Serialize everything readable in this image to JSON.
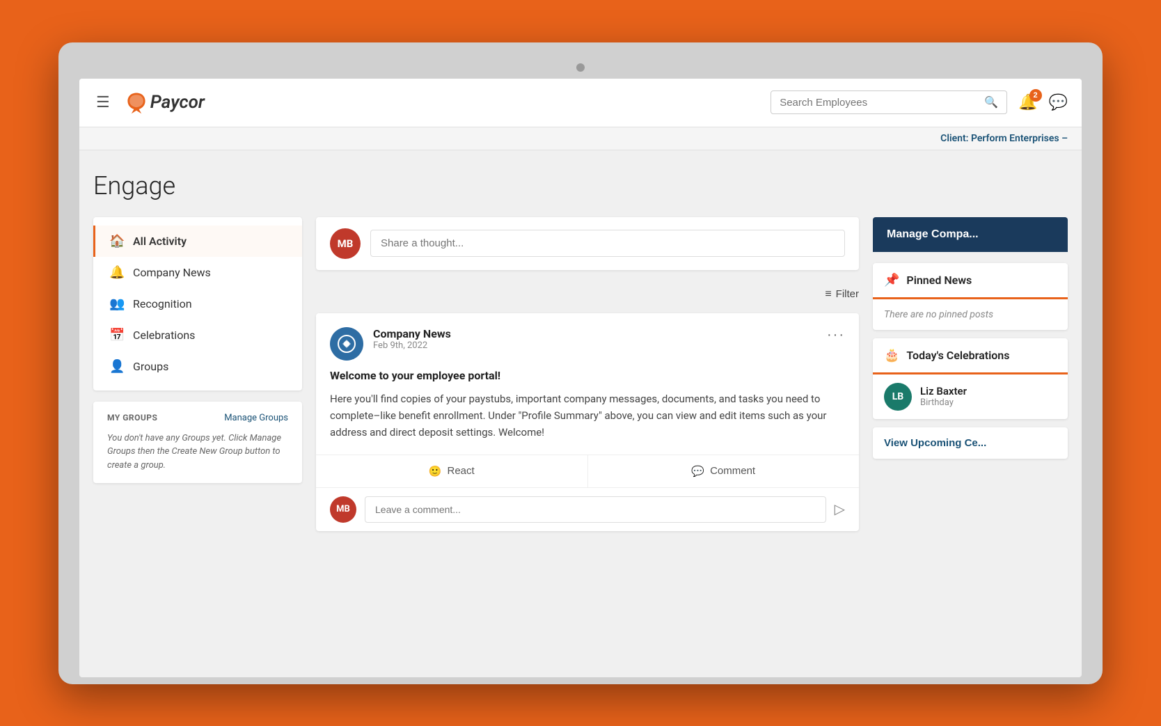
{
  "app": {
    "title": "Paycor",
    "logo_text": "Paycor"
  },
  "header": {
    "menu_icon": "☰",
    "search_placeholder": "Search Employees",
    "notification_count": "2",
    "client_label": "Client:",
    "client_name": "Perform Enterprises –"
  },
  "page": {
    "title": "Engage"
  },
  "sidebar": {
    "nav_items": [
      {
        "id": "all-activity",
        "label": "All Activity",
        "icon": "🏠",
        "active": true
      },
      {
        "id": "company-news",
        "label": "Company News",
        "icon": "🔔",
        "active": false
      },
      {
        "id": "recognition",
        "label": "Recognition",
        "icon": "👥",
        "active": false
      },
      {
        "id": "celebrations",
        "label": "Celebrations",
        "icon": "📅",
        "active": false
      },
      {
        "id": "groups",
        "label": "Groups",
        "icon": "👤",
        "active": false
      }
    ],
    "my_groups_label": "MY GROUPS",
    "manage_groups_link": "Manage Groups",
    "my_groups_empty_text": "You don't have any Groups yet. Click Manage Groups then the Create New Group button to create a group."
  },
  "composer": {
    "user_initials": "MB",
    "placeholder": "Share a thought..."
  },
  "filter": {
    "label": "Filter"
  },
  "post": {
    "avatar_icon": "◈",
    "author": "Company News",
    "date": "Feb 9th, 2022",
    "title": "Welcome to your employee portal!",
    "body": "Here you'll find copies of your paystubs, important company messages, documents, and tasks you need to complete–like benefit enrollment. Under \"Profile Summary\" above, you can view and edit items such as your address and direct deposit settings. Welcome!",
    "react_label": "React",
    "comment_label": "Comment",
    "comment_placeholder": "Leave a comment...",
    "user_initials": "MB"
  },
  "right_sidebar": {
    "manage_company_label": "Manage Compa...",
    "pinned_news": {
      "title": "Pinned News",
      "empty_text": "There are no pinned posts"
    },
    "todays_celebrations": {
      "title": "Today's Celebrations",
      "person_name": "Liz Baxter",
      "person_initials": "LB",
      "celebration_type": "Birthday"
    },
    "view_upcoming_label": "View Upcoming Ce..."
  }
}
